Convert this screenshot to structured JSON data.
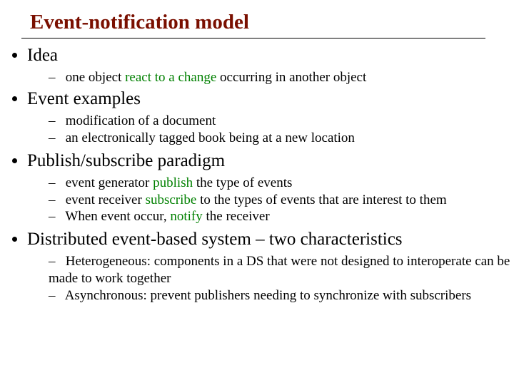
{
  "title": "Event-notification model",
  "bullets": {
    "b1": {
      "label": "Idea"
    },
    "b1s1": {
      "pre": "one object ",
      "kw": "react to a change",
      "post": " occurring in another object"
    },
    "b2": {
      "label": "Event examples"
    },
    "b2s1": {
      "text": "modification of a document"
    },
    "b2s2": {
      "text": "an electronically tagged book being at a new location"
    },
    "b3": {
      "label": "Publish/subscribe paradigm"
    },
    "b3s1": {
      "pre": "event generator ",
      "kw": "publish",
      "post": " the type of events"
    },
    "b3s2": {
      "pre": "event receiver ",
      "kw": "subscribe",
      "post": " to the types of events that are interest to them"
    },
    "b3s3": {
      "pre": "When event occur, ",
      "kw": "notify",
      "post": " the receiver"
    },
    "b4": {
      "label": "Distributed event-based system – two characteristics"
    },
    "b4s1": {
      "text": "Heterogeneous: components in a DS that were not designed to interoperate can be made to work together"
    },
    "b4s2": {
      "text": "Asynchronous: prevent publishers needing to synchronize with subscribers"
    }
  }
}
